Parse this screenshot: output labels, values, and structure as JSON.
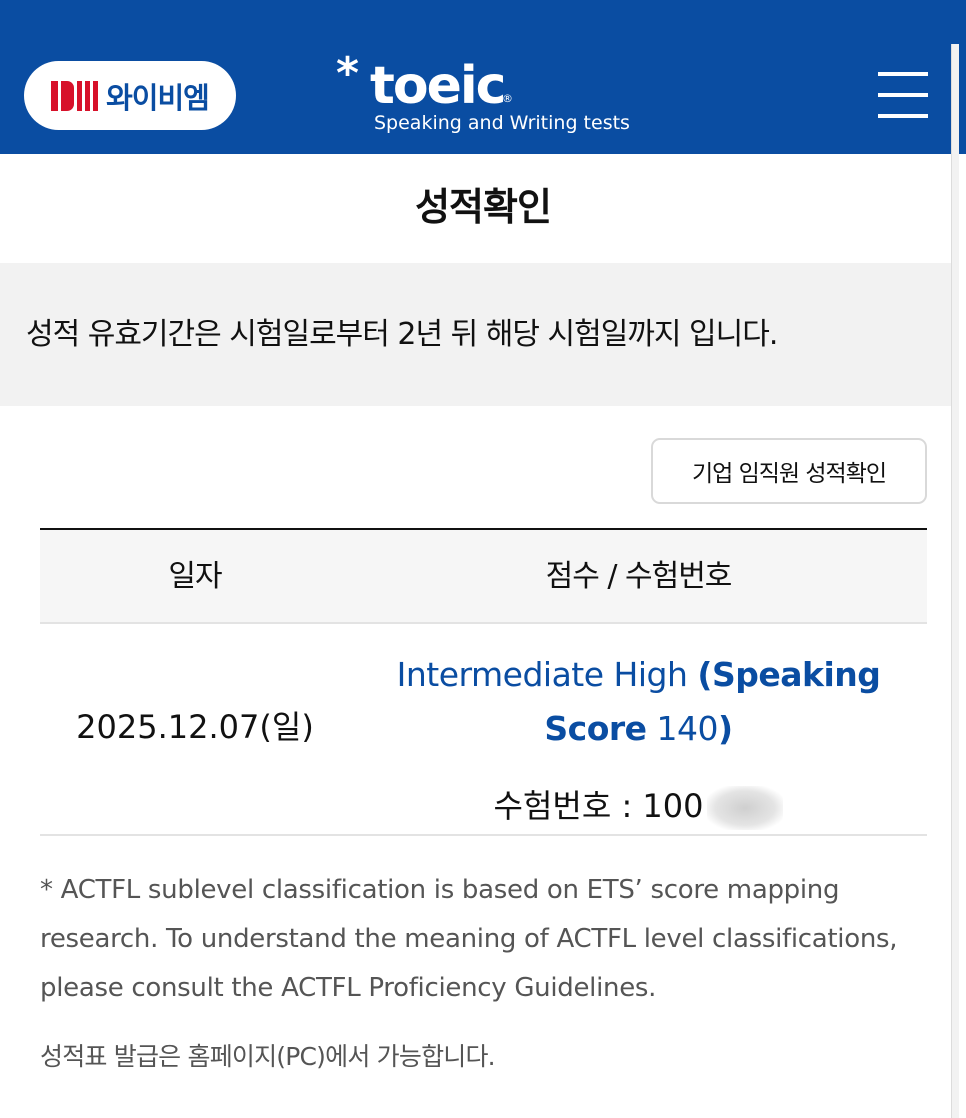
{
  "header": {
    "ybm_logo_text": "와이비엠",
    "toeic_star": "*",
    "toeic_word": "toeic",
    "toeic_reg": "®",
    "toeic_subtitle": "Speaking and Writing tests",
    "menu_icon": "hamburger-menu-icon"
  },
  "page": {
    "title": "성적확인",
    "notice": "성적 유효기간은 시험일로부터 2년 뒤 해당 시험일까지 입니다.",
    "corp_button_label": "기업 임직원 성적확인"
  },
  "table": {
    "headers": [
      "일자",
      "점수 / 수험번호"
    ],
    "rows": [
      {
        "date": "2025.12.07(일)",
        "level": "Intermediate High",
        "score_open": "(Speaking",
        "score_label": "Score",
        "score_value": "140",
        "score_close": ")",
        "exam_number_label": "수험번호 : ",
        "exam_number_visible": "100"
      }
    ]
  },
  "footnote": "* ACTFL sublevel classification is based on ETS’ score mapping research. To understand the meaning of ACTFL level classifications, please consult the ACTFL Proficiency Guidelines.",
  "issue_note": "성적표 발급은 홈페이지(PC)에서 가능합니다.",
  "colors": {
    "brand_blue": "#0a4da2",
    "ybm_red": "#d7112a",
    "notice_bg": "#f2f2f2"
  }
}
